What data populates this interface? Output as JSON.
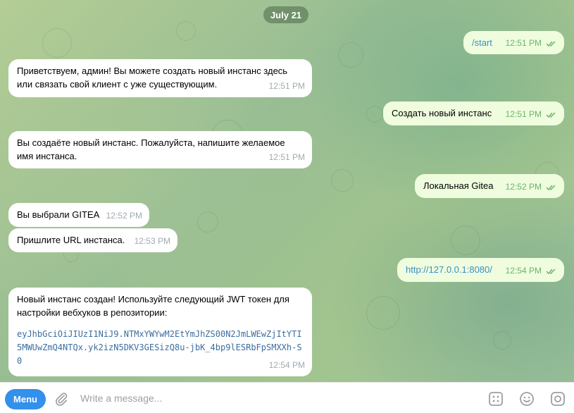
{
  "date_label": "July 21",
  "messages": [
    {
      "dir": "out",
      "text": "/start",
      "time": "12:51 PM",
      "is_command": true
    },
    {
      "dir": "in",
      "text": "Приветствуем, админ! Вы можете создать новый инстанс здесь или связать свой клиент с уже существующим.",
      "time": "12:51 PM"
    },
    {
      "dir": "out",
      "text": "Создать новый инстанс",
      "time": "12:51 PM"
    },
    {
      "dir": "in",
      "text": "Вы создаёте новый инстанс. Пожалуйста, напишите желаемое имя инстанса.",
      "time": "12:51 PM"
    },
    {
      "dir": "out",
      "text": "Локальная Gitea",
      "time": "12:52 PM"
    },
    {
      "dir": "in",
      "text": "Вы выбрали GITEA",
      "time": "12:52 PM"
    },
    {
      "dir": "in",
      "text": "Пришлите URL инстанса.",
      "time": "12:53 PM"
    },
    {
      "dir": "out",
      "text": "http://127.0.0.1:8080/",
      "time": "12:54 PM",
      "is_link": true
    },
    {
      "dir": "in",
      "text": "Новый инстанс создан! Используйте следующий JWT токен для настройки вебхуков в репозитории:",
      "code": "eyJhbGciOiJIUzI1NiJ9.NTMxYWYwM2EtYmJhZS00N2JmLWEwZjItYTI5MWUwZmQ4NTQx.yk2izN5DKV3GESizQ8u-jbK_4bp9lESRbFpSMXXh-S0",
      "time": "12:54 PM"
    }
  ],
  "input_bar": {
    "menu_label": "Menu",
    "placeholder": "Write a message...",
    "icons": [
      "paperclip-icon",
      "bot-commands-icon",
      "emoji-icon",
      "camera-icon"
    ]
  },
  "colors": {
    "incoming_bubble": "#ffffff",
    "outgoing_bubble": "#effdde",
    "read_checks": "#6cb36a",
    "link": "#3a8ec6",
    "menu_button": "#3390ec",
    "date_pill": "#60805c"
  }
}
